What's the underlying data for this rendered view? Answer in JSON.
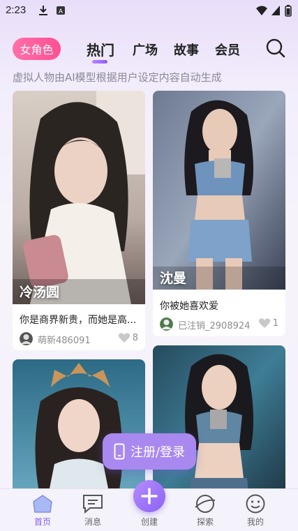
{
  "status_bar": {
    "time": "2:23"
  },
  "top_nav": {
    "category": "女角色",
    "tabs": [
      {
        "label": "热门",
        "active": true
      },
      {
        "label": "广场",
        "active": false
      },
      {
        "label": "故事",
        "active": false
      },
      {
        "label": "会员",
        "active": false
      }
    ]
  },
  "subtitle": "虚拟人物由AI模型根据用户设定内容自动生成",
  "cards": [
    {
      "name": "冷汤圆",
      "title": "你是商界新贵，而她是高...",
      "user": "萌新486091",
      "likes": "8"
    },
    {
      "name": "沈曼",
      "title": "你被她喜欢爱",
      "user": "已注销_2908924",
      "likes": "1"
    },
    {
      "name": "",
      "title": "",
      "user": "",
      "likes": ""
    },
    {
      "name": "",
      "title": "",
      "user": "",
      "likes": ""
    }
  ],
  "login_button": "注册/登录",
  "bottom_nav": [
    {
      "label": "首页",
      "icon": "home-icon",
      "active": true
    },
    {
      "label": "消息",
      "icon": "message-icon",
      "active": false
    },
    {
      "label": "创建",
      "icon": "plus-icon",
      "active": false
    },
    {
      "label": "探索",
      "icon": "planet-icon",
      "active": false
    },
    {
      "label": "我的",
      "icon": "smile-icon",
      "active": false
    }
  ],
  "colors": {
    "accent": "#8a5cf5",
    "pill": "#ff4f93",
    "login": "#a989ef"
  }
}
